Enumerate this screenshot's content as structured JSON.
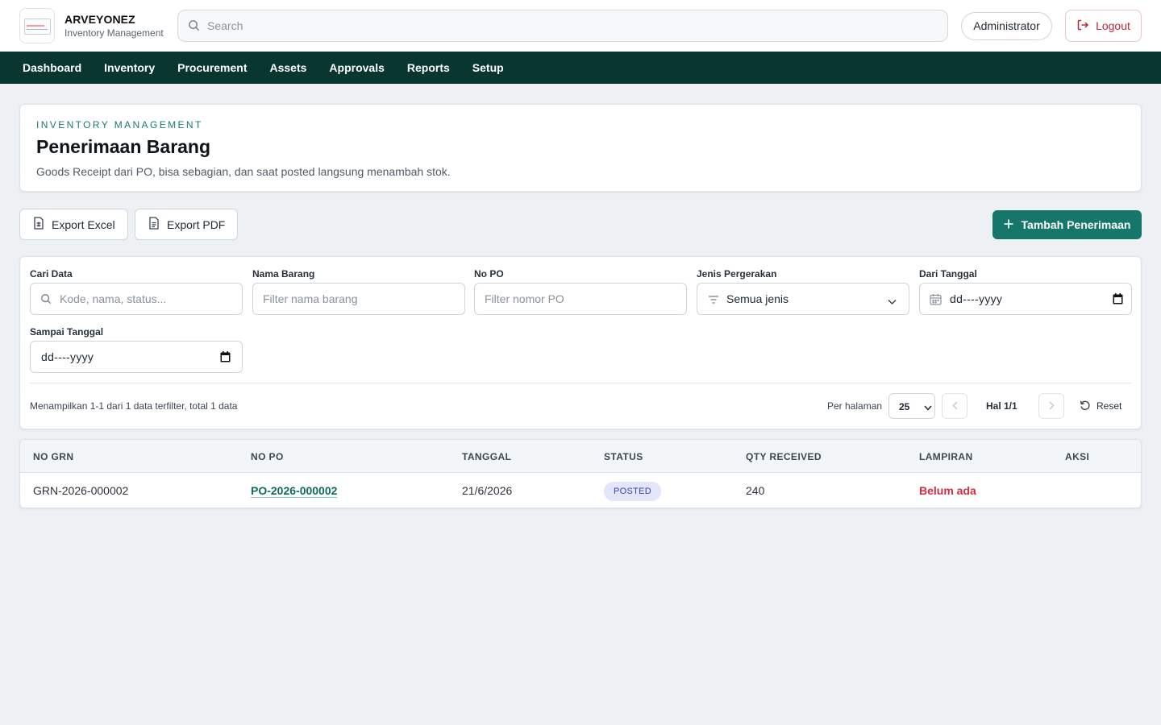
{
  "header": {
    "brand_name": "ARVEYONEZ",
    "brand_sub": "Inventory Management",
    "search_placeholder": "Search",
    "admin_label": "Administrator",
    "logout_label": "Logout"
  },
  "nav": [
    "Dashboard",
    "Inventory",
    "Procurement",
    "Assets",
    "Approvals",
    "Reports",
    "Setup"
  ],
  "page": {
    "eyebrow": "INVENTORY MANAGEMENT",
    "title": "Penerimaan Barang",
    "description": "Goods Receipt dari PO, bisa sebagian, dan saat posted langsung menambah stok."
  },
  "actions": {
    "export_excel": "Export Excel",
    "export_pdf": "Export PDF",
    "add": "Tambah Penerimaan"
  },
  "filters": {
    "search_label": "Cari Data",
    "search_placeholder": "Kode, nama, status...",
    "item_label": "Nama Barang",
    "item_placeholder": "Filter nama barang",
    "po_label": "No PO",
    "po_placeholder": "Filter nomor PO",
    "type_label": "Jenis Pergerakan",
    "type_value": "Semua jenis",
    "from_label": "Dari Tanggal",
    "from_value": "dd----yyyy",
    "to_label": "Sampai Tanggal",
    "to_value": "dd----yyyy"
  },
  "pagination": {
    "summary": "Menampilkan 1-1 dari 1 data terfilter, total 1 data",
    "per_page_label": "Per halaman",
    "per_page_value": "25",
    "page_info": "Hal 1/1",
    "reset_label": "Reset"
  },
  "table": {
    "columns": [
      "NO GRN",
      "NO PO",
      "TANGGAL",
      "STATUS",
      "QTY RECEIVED",
      "LAMPIRAN",
      "AKSI"
    ],
    "rows": [
      {
        "grn": "GRN-2026-000002",
        "po": "PO-2026-000002",
        "date": "21/6/2026",
        "status": "POSTED",
        "qty": "240",
        "attachment": "Belum ada",
        "action": ""
      }
    ]
  },
  "colors": {
    "primary": "#14776a",
    "nav_bg": "#0a3630",
    "danger": "#d12c45",
    "badge_bg": "#e3e6fb"
  }
}
